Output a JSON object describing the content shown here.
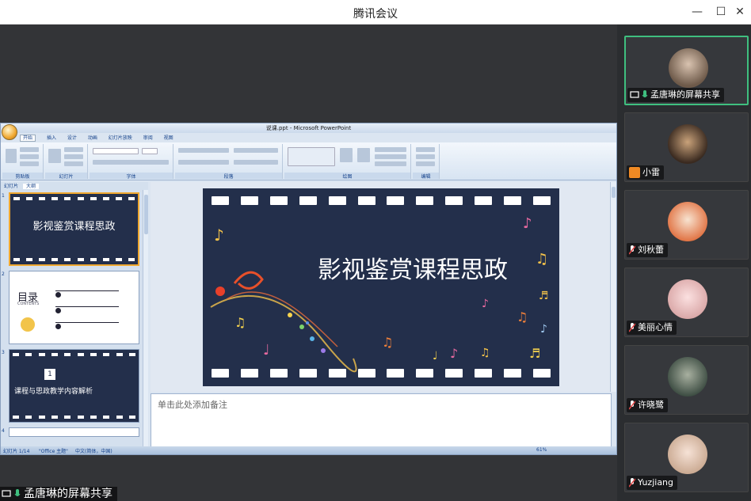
{
  "window": {
    "title": "腾讯会议"
  },
  "powerpoint": {
    "title": "说课.ppt - Microsoft PowerPoint",
    "tabs": [
      "开始",
      "插入",
      "设计",
      "动画",
      "幻灯片放映",
      "审阅",
      "视图"
    ],
    "ribbon_groups": [
      "剪贴板",
      "幻灯片",
      "字体",
      "段落",
      "绘图",
      "编辑"
    ],
    "panel_tabs": [
      "幻灯片",
      "大纲"
    ],
    "thumbnails": [
      {
        "num": "1",
        "title": "影视鉴赏课程思政"
      },
      {
        "num": "2",
        "heading": "目录",
        "sub": "CONTENTS"
      },
      {
        "num": "3",
        "title": "课程与思政教学内容解析",
        "badge": "1"
      },
      {
        "num": "4",
        "title": ""
      }
    ],
    "slide_title": "影视鉴赏课程思政",
    "notes_placeholder": "单击此处添加备注",
    "status": {
      "slide": "幻灯片 1/14",
      "theme": "\"Office 主题\"",
      "lang": "中文(简体，中国)",
      "zoom": "61%"
    }
  },
  "participants": [
    {
      "name": "孟唐琳的屏幕共享",
      "active": true,
      "mic": "on",
      "screen_share": true
    },
    {
      "name": "小雷",
      "mic": "none",
      "avatar_kind": "orange-person-icon"
    },
    {
      "name": "刘秋蕾",
      "mic": "muted"
    },
    {
      "name": "美丽心情",
      "mic": "muted"
    },
    {
      "name": "许晓鹭",
      "mic": "muted"
    },
    {
      "name": "Yuzjiang",
      "mic": "muted"
    }
  ],
  "share_tag": {
    "label": "孟唐琳的屏幕共享"
  },
  "colors": {
    "slide_bg": "#232f4b",
    "accent_green": "#3fbf7f",
    "muted_red": "#e04848"
  }
}
